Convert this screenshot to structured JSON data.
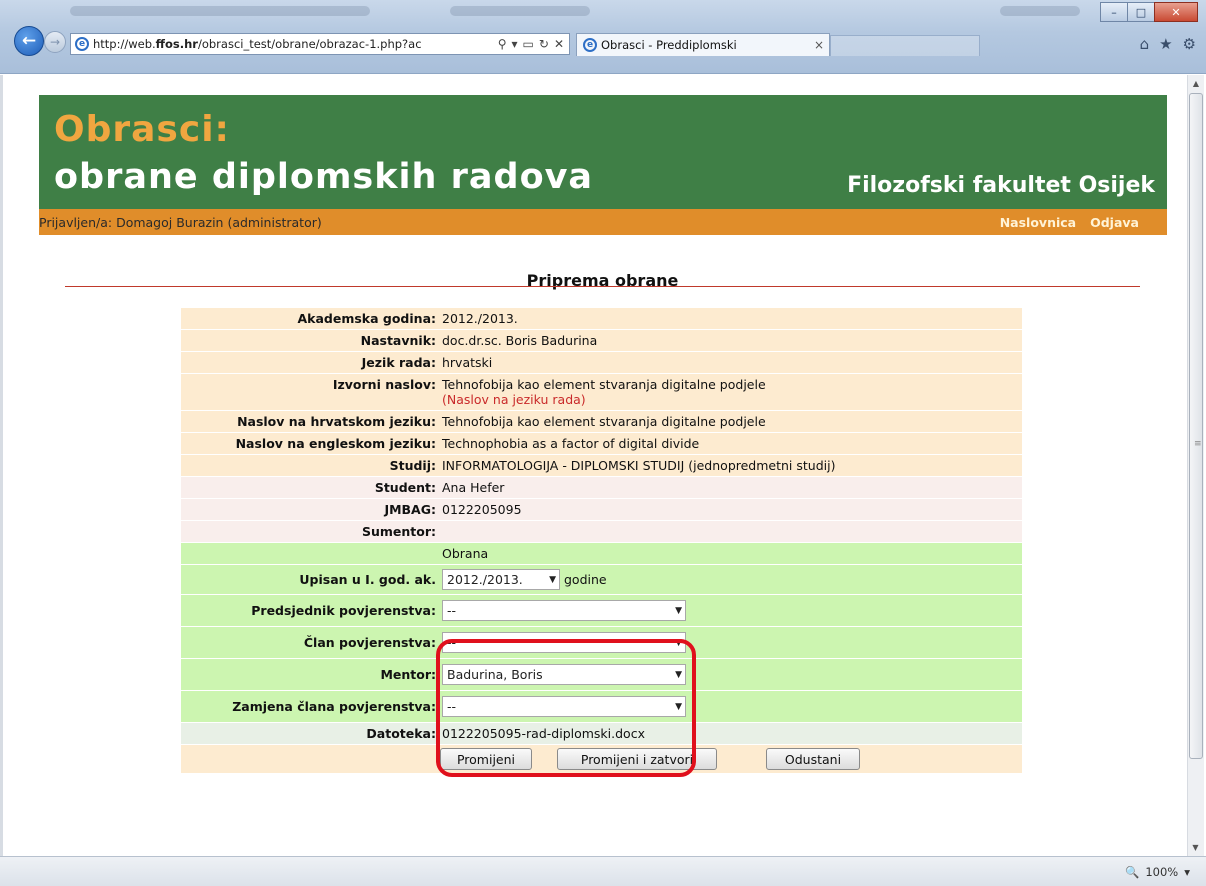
{
  "browser": {
    "url": "http://web.ffos.hr/obrasci_test/obrane/obrazac-1.php?ac",
    "url_bold_part": "ffos.hr",
    "tab_title": "Obrasci - Preddiplomski",
    "tab_close": "×",
    "zoom": "100%",
    "icons": [
      "back-icon",
      "forward-icon",
      "search-icon",
      "refresh-icon",
      "close-icon",
      "home-icon",
      "star-icon",
      "gear-icon"
    ]
  },
  "banner": {
    "title_line1": "Obrasci:",
    "title_line2": "obrane diplomskih radova",
    "faculty": "Filozofski fakultet Osijek",
    "colors": {
      "banner_bg": "#3f7f46",
      "title_accent": "#f0a640",
      "userbar_bg": "#e08d2a"
    }
  },
  "userbar": {
    "user_text": "Prijavljen/a: Domagoj Burazin (administrator)",
    "links": {
      "home": "Naslovnica",
      "logout": "Odjava"
    }
  },
  "page": {
    "heading": "Priprema obrane"
  },
  "form": {
    "akademska_godina": {
      "label": "Akademska godina:",
      "value": "2012./2013."
    },
    "nastavnik": {
      "label": "Nastavnik:",
      "value": "doc.dr.sc. Boris Badurina"
    },
    "jezik_rada": {
      "label": "Jezik rada:",
      "value": "hrvatski"
    },
    "izvorni_naslov": {
      "label": "Izvorni naslov:",
      "value": "Tehnofobija kao element stvaranja digitalne podjele",
      "note": "(Naslov na jeziku rada)"
    },
    "naslov_hr": {
      "label": "Naslov na hrvatskom jeziku:",
      "value": "Tehnofobija kao element stvaranja digitalne podjele"
    },
    "naslov_en": {
      "label": "Naslov na engleskom jeziku:",
      "value": "Technophobia as a factor of digital divide"
    },
    "studij": {
      "label": "Studij:",
      "value": "INFORMATOLOGIJA - DIPLOMSKI STUDIJ (jednopredmetni studij)"
    },
    "student": {
      "label": "Student:",
      "value": "Ana Hefer"
    },
    "jmbag": {
      "label": "JMBAG:",
      "value": "0122205095"
    },
    "sumentor": {
      "label": "Sumentor:",
      "value": ""
    },
    "section_obrana": "Obrana",
    "upisan": {
      "label": "Upisan u I. god. ak.",
      "selected": "2012./2013.",
      "suffix": "godine"
    },
    "predsjednik": {
      "label": "Predsjednik povjerenstva:",
      "selected": "--"
    },
    "clan": {
      "label": "Član povjerenstva:",
      "selected": "--"
    },
    "mentor": {
      "label": "Mentor:",
      "selected": "Badurina, Boris"
    },
    "zamjena": {
      "label": "Zamjena člana povjerenstva:",
      "selected": "--"
    },
    "datoteka": {
      "label": "Datoteka:",
      "value": "0122205095-rad-diplomski.docx"
    },
    "buttons": {
      "change": "Promijeni",
      "change_close": "Promijeni i zatvori",
      "cancel": "Odustani"
    }
  }
}
